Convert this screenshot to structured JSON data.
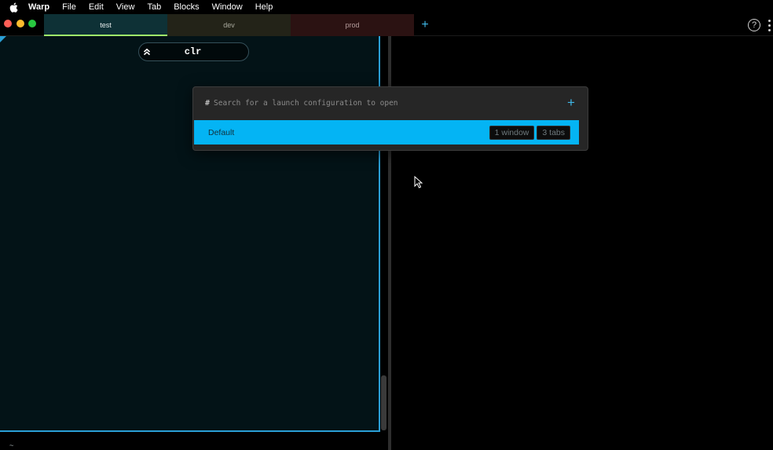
{
  "menubar": {
    "app_name": "Warp",
    "items": [
      "File",
      "Edit",
      "View",
      "Tab",
      "Blocks",
      "Window",
      "Help"
    ]
  },
  "tabs": [
    {
      "label": "test",
      "active": true,
      "color": "#0e3136",
      "accent": "#9ff06a"
    },
    {
      "label": "dev",
      "active": false,
      "color": "#232318"
    },
    {
      "label": "prod",
      "active": false,
      "color": "#2b1212"
    }
  ],
  "tabbar": {
    "add_tab_symbol": "+",
    "help_symbol": "?"
  },
  "left_pane": {
    "block_command": "clr",
    "prompt_symbol": "~"
  },
  "palette": {
    "prefix": "#",
    "placeholder": "Search for a launch configuration to open",
    "add_symbol": "+",
    "selected_item": {
      "label": "Default",
      "windows_badge": "1 window",
      "tabs_badge": "3 tabs"
    },
    "highlight_color": "#04b4f4"
  },
  "colors": {
    "accent_blue": "#2a9fd6",
    "plus_blue": "#3fb8e8"
  }
}
